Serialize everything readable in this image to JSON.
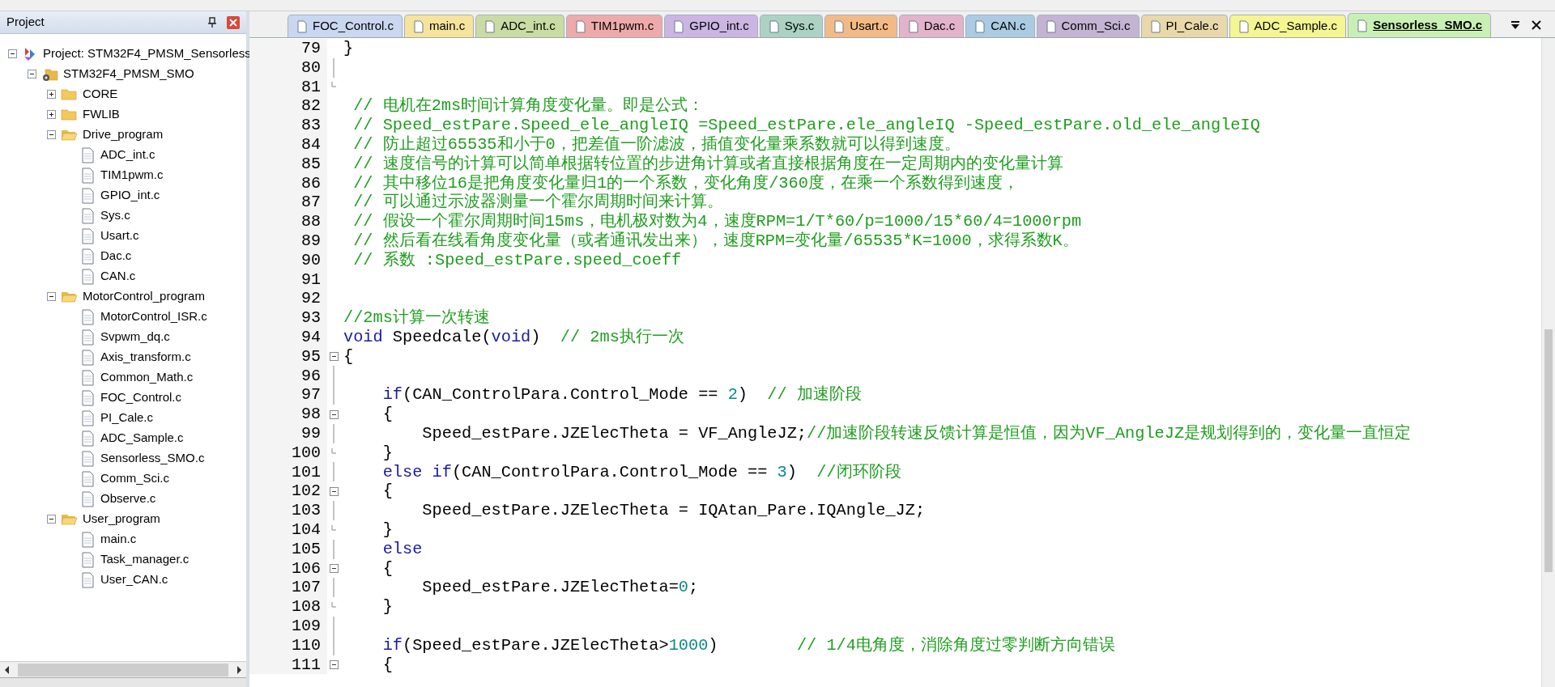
{
  "project_panel": {
    "title": "Project",
    "tree": [
      {
        "kind": "project",
        "label": "Project: STM32F4_PMSM_Sensorless",
        "expanded": true,
        "children": [
          {
            "kind": "target",
            "label": "STM32F4_PMSM_SMO",
            "expanded": true,
            "children": [
              {
                "kind": "folder",
                "label": "CORE",
                "expanded": false
              },
              {
                "kind": "folder",
                "label": "FWLIB",
                "expanded": false
              },
              {
                "kind": "folder",
                "label": "Drive_program",
                "expanded": true,
                "children": [
                  {
                    "kind": "file",
                    "label": "ADC_int.c"
                  },
                  {
                    "kind": "file",
                    "label": "TIM1pwm.c"
                  },
                  {
                    "kind": "file",
                    "label": "GPIO_int.c"
                  },
                  {
                    "kind": "file",
                    "label": "Sys.c"
                  },
                  {
                    "kind": "file",
                    "label": "Usart.c"
                  },
                  {
                    "kind": "file",
                    "label": "Dac.c"
                  },
                  {
                    "kind": "file",
                    "label": "CAN.c"
                  }
                ]
              },
              {
                "kind": "folder",
                "label": "MotorControl_program",
                "expanded": true,
                "children": [
                  {
                    "kind": "file",
                    "label": "MotorControl_ISR.c"
                  },
                  {
                    "kind": "file",
                    "label": "Svpwm_dq.c"
                  },
                  {
                    "kind": "file",
                    "label": "Axis_transform.c"
                  },
                  {
                    "kind": "file",
                    "label": "Common_Math.c"
                  },
                  {
                    "kind": "file",
                    "label": "FOC_Control.c"
                  },
                  {
                    "kind": "file",
                    "label": "PI_Cale.c"
                  },
                  {
                    "kind": "file",
                    "label": "ADC_Sample.c"
                  },
                  {
                    "kind": "file",
                    "label": "Sensorless_SMO.c"
                  },
                  {
                    "kind": "file",
                    "label": "Comm_Sci.c"
                  },
                  {
                    "kind": "file",
                    "label": "Observe.c"
                  }
                ]
              },
              {
                "kind": "folder",
                "label": "User_program",
                "expanded": true,
                "children": [
                  {
                    "kind": "file",
                    "label": "main.c"
                  },
                  {
                    "kind": "file",
                    "label": "Task_manager.c"
                  },
                  {
                    "kind": "file",
                    "label": "User_CAN.c"
                  }
                ]
              }
            ]
          }
        ]
      }
    ]
  },
  "tabs": [
    {
      "label": "FOC_Control.c",
      "color": "#c9d7f0",
      "selected": false
    },
    {
      "label": "main.c",
      "color": "#f6e39c",
      "selected": false
    },
    {
      "label": "ADC_int.c",
      "color": "#c9dca3",
      "selected": false
    },
    {
      "label": "TIM1pwm.c",
      "color": "#eeaaaa",
      "selected": false
    },
    {
      "label": "GPIO_int.c",
      "color": "#cbb5e3",
      "selected": false
    },
    {
      "label": "Sys.c",
      "color": "#abd2c3",
      "selected": false
    },
    {
      "label": "Usart.c",
      "color": "#f4ba86",
      "selected": false
    },
    {
      "label": "Dac.c",
      "color": "#e2b3cb",
      "selected": false
    },
    {
      "label": "CAN.c",
      "color": "#abcbe2",
      "selected": false
    },
    {
      "label": "Comm_Sci.c",
      "color": "#c3b4d3",
      "selected": false
    },
    {
      "label": "PI_Cale.c",
      "color": "#e9d9aa",
      "selected": false
    },
    {
      "label": "ADC_Sample.c",
      "color": "#f5f592",
      "selected": false
    },
    {
      "label": "Sensorless_SMO.c",
      "color": "#c9f0b4",
      "selected": true
    }
  ],
  "editor": {
    "lines": [
      {
        "number": "79",
        "kind": "plain",
        "segments": [
          {
            "kind": "text",
            "text": "}"
          }
        ]
      },
      {
        "number": "80",
        "kind": "fold_line"
      },
      {
        "number": "81",
        "kind": "fold_end"
      },
      {
        "number": "82",
        "kind": "plain",
        "segments": [
          {
            "kind": "comment",
            "text": " // 电机在2ms时间计算角度变化量。即是公式："
          }
        ]
      },
      {
        "number": "83",
        "kind": "plain",
        "segments": [
          {
            "kind": "comment",
            "text": " // Speed_estPare.Speed_ele_angleIQ =Speed_estPare.ele_angleIQ -Speed_estPare.old_ele_angleIQ"
          }
        ]
      },
      {
        "number": "84",
        "kind": "plain",
        "segments": [
          {
            "kind": "comment",
            "text": " // 防止超过65535和小于0，把差值一阶滤波，插值变化量乘系数就可以得到速度。"
          }
        ]
      },
      {
        "number": "85",
        "kind": "plain",
        "segments": [
          {
            "kind": "comment",
            "text": " // 速度信号的计算可以简单根据转位置的步进角计算或者直接根据角度在一定周期内的变化量计算"
          }
        ]
      },
      {
        "number": "86",
        "kind": "plain",
        "segments": [
          {
            "kind": "comment",
            "text": " // 其中移位16是把角度变化量归1的一个系数，变化角度/360度，在乘一个系数得到速度，"
          }
        ]
      },
      {
        "number": "87",
        "kind": "plain",
        "segments": [
          {
            "kind": "comment",
            "text": " // 可以通过示波器测量一个霍尔周期时间来计算。"
          }
        ]
      },
      {
        "number": "88",
        "kind": "plain",
        "segments": [
          {
            "kind": "comment",
            "text": " // 假设一个霍尔周期时间15ms，电机极对数为4，速度RPM=1/T*60/p=1000/15*60/4=1000rpm"
          }
        ]
      },
      {
        "number": "89",
        "kind": "plain",
        "segments": [
          {
            "kind": "comment",
            "text": " // 然后看在线看角度变化量（或者通讯发出来），速度RPM=变化量/65535*K=1000，求得系数K。"
          }
        ]
      },
      {
        "number": "90",
        "kind": "plain",
        "segments": [
          {
            "kind": "comment",
            "text": " // 系数 :Speed_estPare.speed_coeff"
          }
        ]
      },
      {
        "number": "91",
        "kind": "plain"
      },
      {
        "number": "92",
        "kind": "plain"
      },
      {
        "number": "93",
        "kind": "plain",
        "segments": [
          {
            "kind": "comment",
            "text": "//2ms计算一次转速"
          }
        ]
      },
      {
        "number": "94",
        "kind": "plain",
        "segments": [
          {
            "kind": "keyword",
            "text": "void"
          },
          {
            "kind": "text",
            "text": " Speedcale("
          },
          {
            "kind": "keyword",
            "text": "void"
          },
          {
            "kind": "text",
            "text": ")"
          },
          {
            "kind": "comment",
            "text": "  // 2ms执行一次"
          }
        ]
      },
      {
        "number": "95",
        "kind": "fold_start",
        "segments": [
          {
            "kind": "text",
            "text": "{"
          }
        ]
      },
      {
        "number": "96",
        "kind": "fold_line"
      },
      {
        "number": "97",
        "kind": "fold_line",
        "segments": [
          {
            "kind": "keyword",
            "text": "    if"
          },
          {
            "kind": "text",
            "text": "(CAN_ControlPara.Control_Mode == "
          },
          {
            "kind": "number",
            "text": "2"
          },
          {
            "kind": "text",
            "text": ")"
          },
          {
            "kind": "comment",
            "text": "  // 加速阶段"
          }
        ]
      },
      {
        "number": "98",
        "kind": "fold_start",
        "segments": [
          {
            "kind": "text",
            "text": "    {"
          }
        ]
      },
      {
        "number": "99",
        "kind": "fold_line",
        "segments": [
          {
            "kind": "text",
            "text": "        Speed_estPare.JZElecTheta = VF_AngleJZ;"
          },
          {
            "kind": "comment",
            "text": "//加速阶段转速反馈计算是恒值，因为VF_AngleJZ是规划得到的，变化量一直恒定"
          }
        ]
      },
      {
        "number": "100",
        "kind": "fold_end",
        "segments": [
          {
            "kind": "text",
            "text": "    }"
          }
        ]
      },
      {
        "number": "101",
        "kind": "fold_line",
        "segments": [
          {
            "kind": "keyword",
            "text": "    else if"
          },
          {
            "kind": "text",
            "text": "(CAN_ControlPara.Control_Mode == "
          },
          {
            "kind": "number",
            "text": "3"
          },
          {
            "kind": "text",
            "text": ")"
          },
          {
            "kind": "comment",
            "text": "  //闭环阶段"
          }
        ]
      },
      {
        "number": "102",
        "kind": "fold_start",
        "segments": [
          {
            "kind": "text",
            "text": "    {"
          }
        ]
      },
      {
        "number": "103",
        "kind": "fold_line",
        "segments": [
          {
            "kind": "text",
            "text": "        Speed_estPare.JZElecTheta = IQAtan_Pare.IQAngle_JZ;"
          }
        ]
      },
      {
        "number": "104",
        "kind": "fold_end",
        "segments": [
          {
            "kind": "text",
            "text": "    }"
          }
        ]
      },
      {
        "number": "105",
        "kind": "fold_line",
        "segments": [
          {
            "kind": "keyword",
            "text": "    else"
          }
        ]
      },
      {
        "number": "106",
        "kind": "fold_start",
        "segments": [
          {
            "kind": "text",
            "text": "    {"
          }
        ]
      },
      {
        "number": "107",
        "kind": "fold_line",
        "segments": [
          {
            "kind": "text",
            "text": "        Speed_estPare.JZElecTheta="
          },
          {
            "kind": "number",
            "text": "0"
          },
          {
            "kind": "text",
            "text": ";"
          }
        ]
      },
      {
        "number": "108",
        "kind": "fold_end",
        "segments": [
          {
            "kind": "text",
            "text": "    }"
          }
        ]
      },
      {
        "number": "109",
        "kind": "fold_line"
      },
      {
        "number": "110",
        "kind": "fold_line",
        "segments": [
          {
            "kind": "keyword",
            "text": "    if"
          },
          {
            "kind": "text",
            "text": "(Speed_estPare.JZElecTheta>"
          },
          {
            "kind": "number",
            "text": "1000"
          },
          {
            "kind": "text",
            "text": ")"
          },
          {
            "kind": "comment",
            "text": "        // 1/4电角度，消除角度过零判断方向错误"
          }
        ]
      },
      {
        "number": "111",
        "kind": "fold_start",
        "segments": [
          {
            "kind": "text",
            "text": "    {"
          }
        ]
      }
    ]
  }
}
